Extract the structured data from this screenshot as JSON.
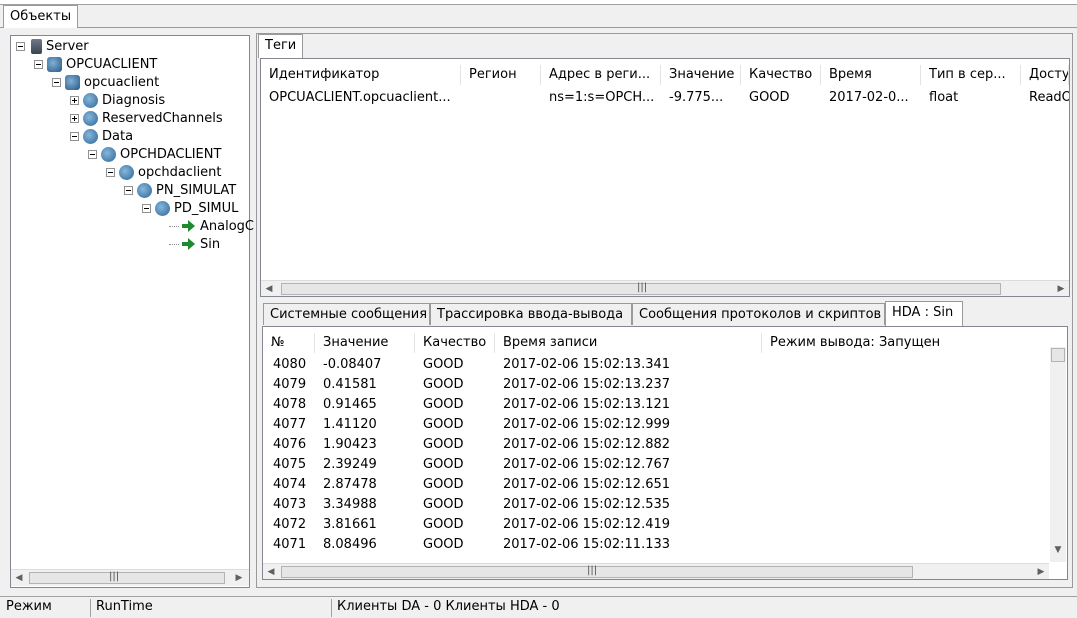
{
  "outer_tab": {
    "label": "Объекты"
  },
  "tree": [
    {
      "label": "Server",
      "icon": "server-icon",
      "expander": "minus"
    },
    {
      "label": "OPCUACLIENT",
      "icon": "client-icon",
      "expander": "minus"
    },
    {
      "label": "opcuaclient",
      "icon": "device-icon",
      "expander": "minus"
    },
    {
      "label": "Diagnosis",
      "icon": "folder-icon",
      "expander": "plus"
    },
    {
      "label": "ReservedChannels",
      "icon": "folder-icon",
      "expander": "plus"
    },
    {
      "label": "Data",
      "icon": "folder-icon",
      "expander": "minus"
    },
    {
      "label": "OPCHDACLIENT",
      "icon": "client-icon",
      "expander": "minus"
    },
    {
      "label": "opchdaclient",
      "icon": "device-icon",
      "expander": "minus"
    },
    {
      "label": "PN_SIMULAT",
      "icon": "folder-icon",
      "expander": "minus"
    },
    {
      "label": "PD_SIMUL",
      "icon": "folder-icon",
      "expander": "minus"
    },
    {
      "label": "AnalogC",
      "icon": "tag-arrow-icon",
      "expander": "none"
    },
    {
      "label": "Sin",
      "icon": "tag-arrow-icon",
      "expander": "none"
    }
  ],
  "tags_tab": {
    "label": "Теги"
  },
  "tags_table": {
    "columns": [
      "Идентификатор",
      "Регион",
      "Адрес в реги...",
      "Значение",
      "Качество",
      "Время",
      "Тип в сер...",
      "Досту"
    ],
    "rows": [
      [
        "OPCUACLIENT.opcuaclient...",
        "",
        "ns=1:s=OPCH...",
        "-9.775...",
        "GOOD",
        "2017-02-0...",
        "float",
        "ReadO"
      ]
    ]
  },
  "bottom_tabs": [
    "Системные сообщения",
    "Трассировка ввода-вывода",
    "Сообщения протоколов и скриптов",
    "HDA : Sin"
  ],
  "hda_table": {
    "columns": [
      "№",
      "Значение",
      "Качество",
      "Время записи"
    ],
    "mode_label": "Режим вывода: Запущен",
    "rows": [
      [
        "4080",
        "-0.08407",
        "GOOD",
        "2017-02-06 15:02:13.341"
      ],
      [
        "4079",
        "0.41581",
        "GOOD",
        "2017-02-06 15:02:13.237"
      ],
      [
        "4078",
        "0.91465",
        "GOOD",
        "2017-02-06 15:02:13.121"
      ],
      [
        "4077",
        "1.41120",
        "GOOD",
        "2017-02-06 15:02:12.999"
      ],
      [
        "4076",
        "1.90423",
        "GOOD",
        "2017-02-06 15:02:12.882"
      ],
      [
        "4075",
        "2.39249",
        "GOOD",
        "2017-02-06 15:02:12.767"
      ],
      [
        "4074",
        "2.87478",
        "GOOD",
        "2017-02-06 15:02:12.651"
      ],
      [
        "4073",
        "3.34988",
        "GOOD",
        "2017-02-06 15:02:12.535"
      ],
      [
        "4072",
        "3.81661",
        "GOOD",
        "2017-02-06 15:02:12.419"
      ],
      [
        "4071",
        "8.08496",
        "GOOD",
        "2017-02-06 15:02:11.133"
      ]
    ]
  },
  "status_bar": {
    "mode_label": "Режим",
    "mode_value": "RunTime",
    "clients": "Клиенты DA - 0 Клиенты HDA - 0"
  },
  "colors": {
    "accent_green": "#1e8a2e",
    "border": "#9a9a9a"
  }
}
